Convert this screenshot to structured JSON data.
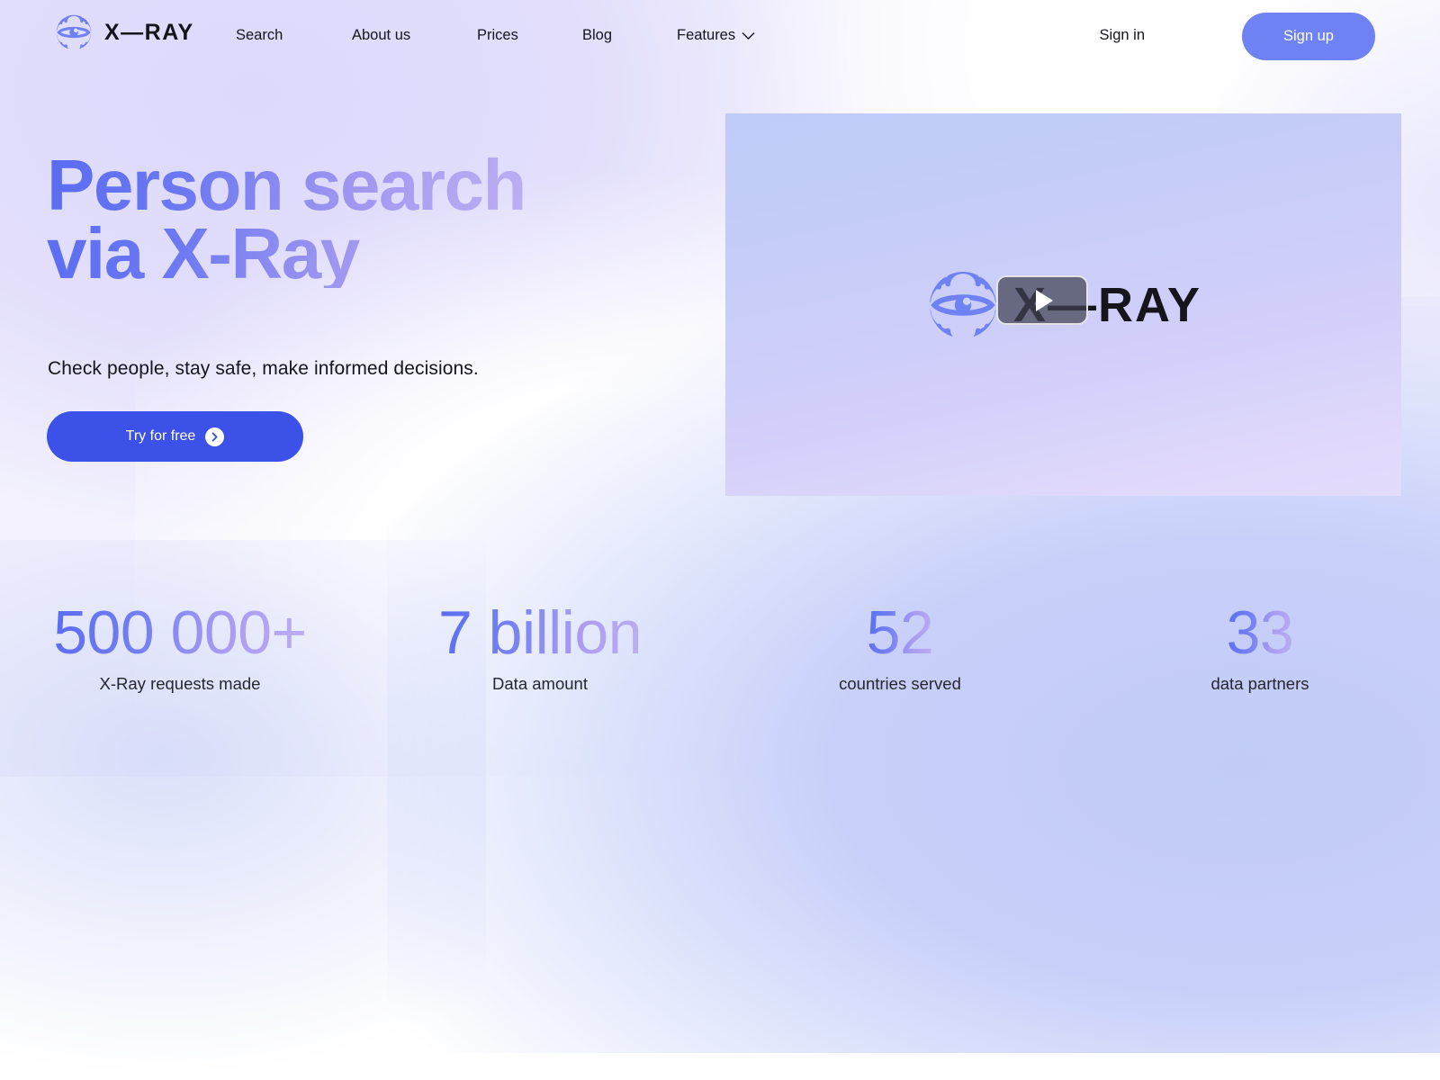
{
  "brand": {
    "name": "X—RAY",
    "logo_icon": "xray-eye-fingerprint-icon"
  },
  "nav": {
    "items": [
      {
        "label": "Search",
        "icon": null
      },
      {
        "label": "About us",
        "icon": null
      },
      {
        "label": "Prices",
        "icon": null
      },
      {
        "label": "Blog",
        "icon": null
      },
      {
        "label": "Features",
        "icon": "chevron-down-icon"
      }
    ]
  },
  "auth": {
    "signin_label": "Sign in",
    "signup_label": "Sign up"
  },
  "hero": {
    "title": "Person search\nvia X-Ray",
    "subtitle": "Check people, stay safe, make informed decisions.",
    "cta_label": "Try for free",
    "cta_icon": "chevron-right-circle-icon"
  },
  "video": {
    "wordmark": "X—RAY",
    "logo_icon": "xray-eye-fingerprint-icon",
    "play_icon": "play-triangle-icon"
  },
  "stats": [
    {
      "value": "500 000+",
      "label": "X-Ray requests made"
    },
    {
      "value": "7 billion",
      "label": "Data amount"
    },
    {
      "value": "52",
      "label": "countries served"
    },
    {
      "value": "33",
      "label": "data partners"
    }
  ],
  "colors": {
    "brand_blue": "#6f82f3",
    "cta_blue": "#3c51e8",
    "gradient_start": "#5a6cf2",
    "gradient_end": "#bdb0f3",
    "text_dark": "#14161c",
    "panel_top": "#bfcbf9",
    "panel_bottom": "#e3dcfc"
  }
}
